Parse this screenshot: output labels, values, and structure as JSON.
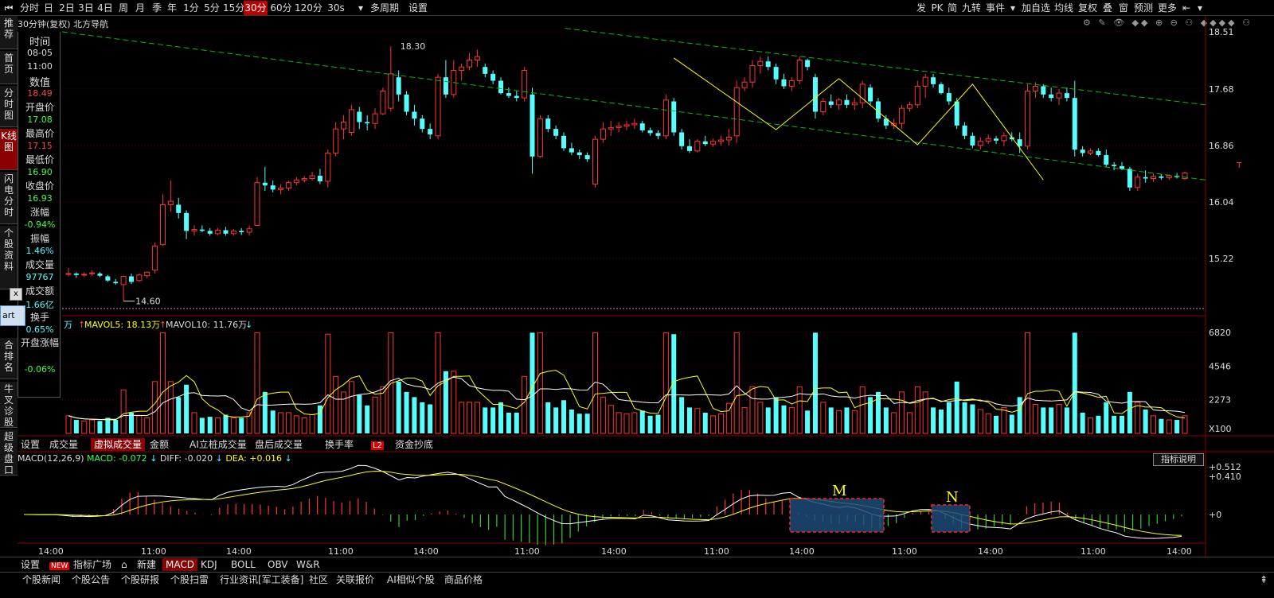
{
  "toolbar": {
    "items": [
      "⏮",
      "分时",
      "日",
      "2日",
      "3日",
      "4日",
      "周",
      "月",
      "季",
      "年",
      "1分",
      "5分",
      "15分",
      "30分",
      "60分",
      "120分",
      "30s",
      "▾",
      "多周期",
      "设置"
    ],
    "right": [
      "发",
      "PK",
      "简",
      "九转",
      "事件",
      "▾",
      "加自选",
      "均线",
      "复权",
      "叠",
      "窗",
      "预测",
      "更多",
      "⇤",
      "▾"
    ]
  },
  "chart_title": "30分钟(复权) 北方导航",
  "top_icons": "⚙ ✎ 👁 ◆◆ ⊕ ⊖ ⚇ ◆◆◆◆ ⚇",
  "sidebar": [
    "推荐",
    "首页",
    "分时图",
    "K线图",
    "闪电分时",
    "个股资料",
    "合排名",
    "牛叉诊股",
    "超级盘口"
  ],
  "info": {
    "time_label": "时间",
    "date": "08-05",
    "time": "11:00",
    "value_label": "数值",
    "value": "18.49",
    "open_label": "开盘价",
    "open": "17.08",
    "high_label": "最高价",
    "high": "17.15",
    "low_label": "最低价",
    "low": "16.90",
    "close_label": "收盘价",
    "close": "16.93",
    "chg_label": "涨幅",
    "chg": "-0.94%",
    "amp_label": "振幅",
    "amp": "1.46%",
    "vol_label": "成交量",
    "vol": "97767",
    "amt_label": "成交额",
    "amt": "1.66亿",
    "turn_label": "换手",
    "turn": "0.65%",
    "open_chg_label": "开盘涨幅",
    "open_chg": "-0.06%"
  },
  "popup": {
    "close": "x",
    "label": "art"
  },
  "vol_header": {
    "unit": "万",
    "ma5_label": "MAVOL5:",
    "ma5": "18.13万",
    "ma10_label": "MAVOL10:",
    "ma10": "11.76万"
  },
  "pane_tabs": [
    "设置",
    "成交量",
    "虚拟成交量",
    "金额",
    "AI立桩成交量",
    "盘后成交量",
    "换手率",
    "L2",
    "资金抄底"
  ],
  "macd_header": {
    "name": "MACD(12,26,9)",
    "macd": "MACD: -0.072",
    "diff": "DIFF: -0.020",
    "dea": "DEA: +0.016"
  },
  "zhibiao_btn": "指标说明",
  "bottom_tabs": [
    "设置",
    "NEW",
    "指标广场",
    "⌂",
    "新建",
    "MACD",
    "KDJ",
    "BOLL",
    "OBV",
    "W&R"
  ],
  "bottom_tabs2": [
    "个股新闻",
    "个股公告",
    "个股研报",
    "个股扫雷",
    "行业资讯[军工装备]",
    "社区",
    "关联报价",
    "AI相似个股",
    "商品价格"
  ],
  "colors": {
    "up": "#ff3333",
    "down": "#54ffff",
    "ma_yellow": "#ffff00",
    "ma_white": "#ffffff",
    "channel": "#00c000",
    "bg": "#000000",
    "axis": "#8b0000"
  },
  "chart_data": {
    "type": "candlestick",
    "price_axis": {
      "ticks": [
        "18.51",
        "17.68",
        "16.86",
        "16.04",
        "15.22"
      ],
      "values": [
        18.51,
        17.68,
        16.86,
        16.04,
        15.22
      ]
    },
    "time_labels": [
      "14:00",
      "11:00",
      "14:00",
      "11:00",
      "14:00",
      "11:00",
      "14:00",
      "11:00",
      "14:00",
      "11:00",
      "14:00",
      "11:00",
      "14:00"
    ],
    "price_annotations": [
      "18.30",
      "14.60"
    ],
    "T_label": "T",
    "candles": [
      {
        "o": 15.0,
        "h": 15.08,
        "l": 14.96,
        "c": 15.0
      },
      {
        "o": 15.0,
        "h": 15.02,
        "l": 14.94,
        "c": 14.98
      },
      {
        "o": 14.98,
        "h": 15.02,
        "l": 14.95,
        "c": 14.99
      },
      {
        "o": 15.0,
        "h": 15.05,
        "l": 14.97,
        "c": 15.01
      },
      {
        "o": 15.0,
        "h": 15.02,
        "l": 14.95,
        "c": 14.97
      },
      {
        "o": 14.96,
        "h": 14.98,
        "l": 14.88,
        "c": 14.9
      },
      {
        "o": 14.88,
        "h": 14.92,
        "l": 14.84,
        "c": 14.86
      },
      {
        "o": 14.84,
        "h": 14.97,
        "l": 14.6,
        "c": 14.96
      },
      {
        "o": 14.96,
        "h": 15.0,
        "l": 14.85,
        "c": 14.88
      },
      {
        "o": 14.9,
        "h": 15.0,
        "l": 14.88,
        "c": 14.98
      },
      {
        "o": 14.97,
        "h": 15.03,
        "l": 14.93,
        "c": 15.02
      },
      {
        "o": 15.05,
        "h": 15.45,
        "l": 15.0,
        "c": 15.4
      },
      {
        "o": 15.42,
        "h": 16.15,
        "l": 15.4,
        "c": 16.0
      },
      {
        "o": 16.0,
        "h": 16.35,
        "l": 15.9,
        "c": 16.05
      },
      {
        "o": 16.0,
        "h": 16.1,
        "l": 15.8,
        "c": 15.88
      },
      {
        "o": 15.88,
        "h": 15.92,
        "l": 15.5,
        "c": 15.62
      },
      {
        "o": 15.62,
        "h": 15.7,
        "l": 15.55,
        "c": 15.64
      },
      {
        "o": 15.64,
        "h": 15.7,
        "l": 15.6,
        "c": 15.62
      },
      {
        "o": 15.62,
        "h": 15.66,
        "l": 15.55,
        "c": 15.58
      },
      {
        "o": 15.58,
        "h": 15.66,
        "l": 15.56,
        "c": 15.63
      },
      {
        "o": 15.63,
        "h": 15.68,
        "l": 15.55,
        "c": 15.58
      },
      {
        "o": 15.58,
        "h": 15.65,
        "l": 15.55,
        "c": 15.62
      },
      {
        "o": 15.62,
        "h": 15.66,
        "l": 15.56,
        "c": 15.6
      },
      {
        "o": 15.6,
        "h": 15.7,
        "l": 15.55,
        "c": 15.65
      },
      {
        "o": 15.7,
        "h": 16.4,
        "l": 15.7,
        "c": 16.32
      },
      {
        "o": 16.32,
        "h": 16.55,
        "l": 16.2,
        "c": 16.28
      },
      {
        "o": 16.28,
        "h": 16.35,
        "l": 16.18,
        "c": 16.22
      },
      {
        "o": 16.22,
        "h": 16.3,
        "l": 16.15,
        "c": 16.24
      },
      {
        "o": 16.24,
        "h": 16.35,
        "l": 16.2,
        "c": 16.32
      },
      {
        "o": 16.32,
        "h": 16.4,
        "l": 16.28,
        "c": 16.36
      },
      {
        "o": 16.36,
        "h": 16.42,
        "l": 16.32,
        "c": 16.38
      },
      {
        "o": 16.38,
        "h": 16.48,
        "l": 16.35,
        "c": 16.42
      },
      {
        "o": 16.42,
        "h": 16.52,
        "l": 16.3,
        "c": 16.34
      },
      {
        "o": 16.34,
        "h": 16.8,
        "l": 16.25,
        "c": 16.75
      },
      {
        "o": 16.75,
        "h": 17.2,
        "l": 16.7,
        "c": 17.1
      },
      {
        "o": 17.1,
        "h": 17.3,
        "l": 16.95,
        "c": 17.2
      },
      {
        "o": 17.05,
        "h": 17.45,
        "l": 17.0,
        "c": 17.38
      },
      {
        "o": 17.35,
        "h": 17.42,
        "l": 17.1,
        "c": 17.2
      },
      {
        "o": 17.2,
        "h": 17.3,
        "l": 17.08,
        "c": 17.18
      },
      {
        "o": 17.18,
        "h": 17.4,
        "l": 17.1,
        "c": 17.32
      },
      {
        "o": 17.32,
        "h": 17.7,
        "l": 17.3,
        "c": 17.65
      },
      {
        "o": 17.4,
        "h": 18.3,
        "l": 17.35,
        "c": 17.9
      },
      {
        "o": 17.85,
        "h": 17.95,
        "l": 17.5,
        "c": 17.6
      },
      {
        "o": 17.6,
        "h": 17.65,
        "l": 17.3,
        "c": 17.35
      },
      {
        "o": 17.35,
        "h": 17.45,
        "l": 17.15,
        "c": 17.25
      },
      {
        "o": 17.25,
        "h": 17.3,
        "l": 17.05,
        "c": 17.1
      },
      {
        "o": 17.1,
        "h": 17.18,
        "l": 16.95,
        "c": 17.02
      },
      {
        "o": 17.0,
        "h": 17.9,
        "l": 16.95,
        "c": 17.85
      },
      {
        "o": 17.85,
        "h": 18.1,
        "l": 17.55,
        "c": 17.6
      },
      {
        "o": 17.6,
        "h": 18.1,
        "l": 17.55,
        "c": 17.95
      },
      {
        "o": 17.95,
        "h": 18.05,
        "l": 17.8,
        "c": 18.0
      },
      {
        "o": 18.0,
        "h": 18.2,
        "l": 17.95,
        "c": 18.1
      },
      {
        "o": 18.1,
        "h": 18.25,
        "l": 18.0,
        "c": 18.15
      },
      {
        "o": 18.0,
        "h": 18.05,
        "l": 17.85,
        "c": 17.9
      },
      {
        "o": 17.9,
        "h": 17.95,
        "l": 17.75,
        "c": 17.8
      },
      {
        "o": 17.8,
        "h": 17.85,
        "l": 17.6,
        "c": 17.62
      },
      {
        "o": 17.62,
        "h": 17.7,
        "l": 17.55,
        "c": 17.58
      },
      {
        "o": 17.58,
        "h": 17.65,
        "l": 17.5,
        "c": 17.55
      },
      {
        "o": 17.55,
        "h": 18.0,
        "l": 17.5,
        "c": 17.95
      },
      {
        "o": 17.6,
        "h": 17.7,
        "l": 16.45,
        "c": 16.7
      },
      {
        "o": 16.7,
        "h": 17.3,
        "l": 16.68,
        "c": 17.25
      },
      {
        "o": 17.25,
        "h": 17.3,
        "l": 17.05,
        "c": 17.1
      },
      {
        "o": 17.1,
        "h": 17.15,
        "l": 16.95,
        "c": 17.0
      },
      {
        "o": 17.0,
        "h": 17.05,
        "l": 16.78,
        "c": 16.82
      },
      {
        "o": 16.82,
        "h": 16.9,
        "l": 16.72,
        "c": 16.76
      },
      {
        "o": 16.76,
        "h": 16.8,
        "l": 16.66,
        "c": 16.72
      },
      {
        "o": 16.72,
        "h": 16.76,
        "l": 16.62,
        "c": 16.66
      },
      {
        "o": 16.3,
        "h": 17.0,
        "l": 16.25,
        "c": 16.95
      },
      {
        "o": 16.95,
        "h": 17.2,
        "l": 16.9,
        "c": 17.1
      },
      {
        "o": 17.1,
        "h": 17.22,
        "l": 17.0,
        "c": 17.12
      },
      {
        "o": 17.12,
        "h": 17.2,
        "l": 17.05,
        "c": 17.14
      },
      {
        "o": 17.14,
        "h": 17.22,
        "l": 17.08,
        "c": 17.16
      },
      {
        "o": 17.16,
        "h": 17.25,
        "l": 17.1,
        "c": 17.18
      },
      {
        "o": 17.18,
        "h": 17.22,
        "l": 17.05,
        "c": 17.08
      },
      {
        "o": 17.08,
        "h": 17.12,
        "l": 17.0,
        "c": 17.04
      },
      {
        "o": 17.04,
        "h": 17.08,
        "l": 16.95,
        "c": 17.0
      },
      {
        "o": 17.0,
        "h": 17.6,
        "l": 16.95,
        "c": 17.52
      },
      {
        "o": 17.5,
        "h": 17.55,
        "l": 17.0,
        "c": 17.05
      },
      {
        "o": 17.05,
        "h": 17.1,
        "l": 16.8,
        "c": 16.85
      },
      {
        "o": 16.85,
        "h": 16.95,
        "l": 16.75,
        "c": 16.78
      },
      {
        "o": 16.78,
        "h": 16.95,
        "l": 16.76,
        "c": 16.92
      },
      {
        "o": 16.92,
        "h": 17.0,
        "l": 16.85,
        "c": 16.88
      },
      {
        "o": 16.88,
        "h": 16.96,
        "l": 16.84,
        "c": 16.92
      },
      {
        "o": 16.92,
        "h": 17.0,
        "l": 16.86,
        "c": 16.94
      },
      {
        "o": 16.94,
        "h": 17.1,
        "l": 16.86,
        "c": 16.98
      },
      {
        "o": 17.0,
        "h": 17.8,
        "l": 16.9,
        "c": 17.7
      },
      {
        "o": 17.7,
        "h": 17.85,
        "l": 17.65,
        "c": 17.78
      },
      {
        "o": 17.78,
        "h": 18.1,
        "l": 17.7,
        "c": 18.02
      },
      {
        "o": 18.02,
        "h": 18.15,
        "l": 17.9,
        "c": 18.08
      },
      {
        "o": 18.08,
        "h": 18.15,
        "l": 17.95,
        "c": 18.0
      },
      {
        "o": 18.0,
        "h": 18.05,
        "l": 17.75,
        "c": 17.82
      },
      {
        "o": 17.82,
        "h": 17.9,
        "l": 17.68,
        "c": 17.72
      },
      {
        "o": 17.72,
        "h": 17.85,
        "l": 17.65,
        "c": 17.8
      },
      {
        "o": 17.8,
        "h": 18.15,
        "l": 17.75,
        "c": 18.1
      },
      {
        "o": 18.1,
        "h": 18.12,
        "l": 17.95,
        "c": 18.0
      },
      {
        "o": 17.85,
        "h": 17.9,
        "l": 17.25,
        "c": 17.35
      },
      {
        "o": 17.35,
        "h": 17.55,
        "l": 17.3,
        "c": 17.5
      },
      {
        "o": 17.5,
        "h": 17.6,
        "l": 17.4,
        "c": 17.45
      },
      {
        "o": 17.45,
        "h": 17.55,
        "l": 17.38,
        "c": 17.52
      },
      {
        "o": 17.52,
        "h": 17.6,
        "l": 17.4,
        "c": 17.45
      },
      {
        "o": 17.45,
        "h": 17.55,
        "l": 17.38,
        "c": 17.48
      },
      {
        "o": 17.48,
        "h": 17.8,
        "l": 17.4,
        "c": 17.75
      },
      {
        "o": 17.7,
        "h": 17.75,
        "l": 17.45,
        "c": 17.5
      },
      {
        "o": 17.5,
        "h": 17.55,
        "l": 17.2,
        "c": 17.25
      },
      {
        "o": 17.25,
        "h": 17.3,
        "l": 17.1,
        "c": 17.15
      },
      {
        "o": 17.15,
        "h": 17.25,
        "l": 17.1,
        "c": 17.18
      },
      {
        "o": 17.18,
        "h": 17.45,
        "l": 17.1,
        "c": 17.4
      },
      {
        "o": 17.4,
        "h": 17.5,
        "l": 17.35,
        "c": 17.45
      },
      {
        "o": 17.45,
        "h": 17.8,
        "l": 17.4,
        "c": 17.72
      },
      {
        "o": 17.72,
        "h": 17.9,
        "l": 17.55,
        "c": 17.85
      },
      {
        "o": 17.85,
        "h": 17.9,
        "l": 17.7,
        "c": 17.75
      },
      {
        "o": 17.75,
        "h": 17.78,
        "l": 17.6,
        "c": 17.62
      },
      {
        "o": 17.62,
        "h": 17.7,
        "l": 17.45,
        "c": 17.5
      },
      {
        "o": 17.5,
        "h": 17.55,
        "l": 17.1,
        "c": 17.15
      },
      {
        "o": 17.15,
        "h": 17.2,
        "l": 16.95,
        "c": 17.0
      },
      {
        "o": 17.0,
        "h": 17.05,
        "l": 16.82,
        "c": 16.86
      },
      {
        "o": 16.86,
        "h": 16.98,
        "l": 16.8,
        "c": 16.92
      },
      {
        "o": 16.92,
        "h": 17.02,
        "l": 16.88,
        "c": 16.96
      },
      {
        "o": 16.96,
        "h": 17.0,
        "l": 16.88,
        "c": 16.93
      },
      {
        "o": 16.93,
        "h": 17.05,
        "l": 16.85,
        "c": 17.0
      },
      {
        "o": 16.98,
        "h": 17.05,
        "l": 16.92,
        "c": 16.95
      },
      {
        "o": 16.95,
        "h": 17.05,
        "l": 16.75,
        "c": 16.85
      },
      {
        "o": 16.85,
        "h": 17.75,
        "l": 16.8,
        "c": 17.65
      },
      {
        "o": 17.65,
        "h": 17.78,
        "l": 17.55,
        "c": 17.72
      },
      {
        "o": 17.72,
        "h": 17.75,
        "l": 17.55,
        "c": 17.6
      },
      {
        "o": 17.6,
        "h": 17.7,
        "l": 17.5,
        "c": 17.55
      },
      {
        "o": 17.55,
        "h": 17.68,
        "l": 17.45,
        "c": 17.62
      },
      {
        "o": 17.62,
        "h": 17.7,
        "l": 17.5,
        "c": 17.55
      },
      {
        "o": 17.55,
        "h": 17.8,
        "l": 16.7,
        "c": 16.8
      },
      {
        "o": 16.8,
        "h": 16.85,
        "l": 16.7,
        "c": 16.75
      },
      {
        "o": 16.75,
        "h": 16.82,
        "l": 16.72,
        "c": 16.78
      },
      {
        "o": 16.78,
        "h": 16.82,
        "l": 16.7,
        "c": 16.72
      },
      {
        "o": 16.72,
        "h": 16.8,
        "l": 16.55,
        "c": 16.58
      },
      {
        "o": 16.58,
        "h": 16.62,
        "l": 16.5,
        "c": 16.56
      },
      {
        "o": 16.56,
        "h": 16.62,
        "l": 16.5,
        "c": 16.52
      },
      {
        "o": 16.52,
        "h": 16.55,
        "l": 16.2,
        "c": 16.25
      },
      {
        "o": 16.25,
        "h": 16.45,
        "l": 16.2,
        "c": 16.4
      },
      {
        "o": 16.4,
        "h": 16.5,
        "l": 16.32,
        "c": 16.38
      },
      {
        "o": 16.38,
        "h": 16.45,
        "l": 16.33,
        "c": 16.41
      },
      {
        "o": 16.41,
        "h": 16.45,
        "l": 16.36,
        "c": 16.39
      },
      {
        "o": 16.39,
        "h": 16.44,
        "l": 16.36,
        "c": 16.42
      },
      {
        "o": 16.42,
        "h": 16.46,
        "l": 16.38,
        "c": 16.4
      },
      {
        "o": 16.38,
        "h": 16.48,
        "l": 16.36,
        "c": 16.46
      }
    ],
    "channels": [
      {
        "x1": 0,
        "y1": 18.51,
        "x2": 1,
        "y2": 16.36
      },
      {
        "x1": 0.44,
        "y1": 18.56,
        "x2": 1,
        "y2": 17.45
      }
    ],
    "volume_axis": {
      "ticks": [
        "6820",
        "4546",
        "2273",
        "X100"
      ],
      "values": [
        6820,
        4546,
        2273,
        0
      ]
    },
    "macd_axis": {
      "ticks": [
        "+0.512",
        "+0.410",
        "+0"
      ],
      "values": [
        0.512,
        0.41,
        0
      ]
    },
    "boxes": [
      {
        "label": "M"
      },
      {
        "label": "N"
      }
    ]
  }
}
